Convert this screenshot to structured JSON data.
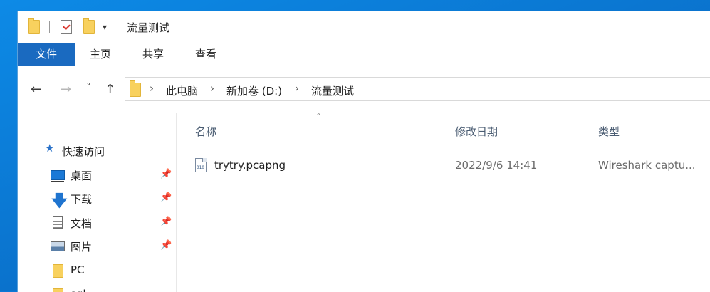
{
  "window": {
    "title": "流量测试"
  },
  "quick_access_toolbar": {
    "icons": [
      "folder-icon",
      "properties-icon",
      "new-folder-icon",
      "customize-dropdown-icon"
    ]
  },
  "ribbon": {
    "tabs": [
      {
        "label": "文件",
        "active": true
      },
      {
        "label": "主页"
      },
      {
        "label": "共享"
      },
      {
        "label": "查看"
      }
    ]
  },
  "navigation": {
    "back": "←",
    "forward": "→",
    "recent": "˅",
    "up": "↑"
  },
  "address_bar": {
    "crumbs": [
      "此电脑",
      "新加卷 (D:)",
      "流量测试"
    ],
    "separator": "›"
  },
  "nav_pane": {
    "quick_access_label": "快速访问",
    "items": [
      {
        "label": "桌面",
        "icon": "desktop-icon",
        "pinned": true
      },
      {
        "label": "下载",
        "icon": "download-icon",
        "pinned": true
      },
      {
        "label": "文档",
        "icon": "document-icon",
        "pinned": true
      },
      {
        "label": "图片",
        "icon": "picture-icon",
        "pinned": true
      },
      {
        "label": "PC",
        "icon": "folder-icon",
        "pinned": false
      },
      {
        "label": "sql",
        "icon": "folder-icon",
        "pinned": false
      }
    ],
    "pin_glyph": "📌"
  },
  "file_list": {
    "sort_indicator": "˄",
    "columns": [
      "名称",
      "修改日期",
      "类型"
    ],
    "rows": [
      {
        "name": "trytry.pcapng",
        "modified": "2022/9/6 14:41",
        "type": "Wireshark captu...",
        "icon_text": "010"
      }
    ]
  },
  "colors": {
    "accent": "#1a6ac0",
    "desktop_bg": "#0a78d7",
    "folder": "#f8d15e"
  }
}
